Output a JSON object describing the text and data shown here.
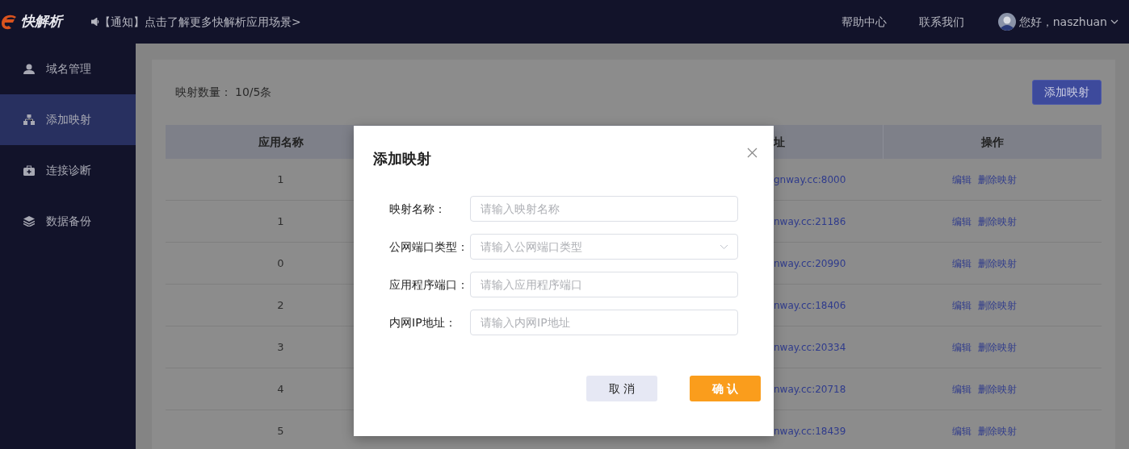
{
  "topbar": {
    "logo_text": "快解析",
    "notice": "【通知】点击了解更多快解析应用场景>",
    "links": [
      "帮助中心",
      "联系我们"
    ],
    "greeting": "您好，naszhuan"
  },
  "sidebar": {
    "items": [
      {
        "label": "域名管理",
        "selected": false
      },
      {
        "label": "添加映射",
        "selected": true
      },
      {
        "label": "连接诊断",
        "selected": false
      },
      {
        "label": "数据备份",
        "selected": false
      }
    ]
  },
  "summary": {
    "label": "映射数量：",
    "value": "10/5条"
  },
  "add_button": "添加映射",
  "table": {
    "columns": [
      {
        "label": "应用名称"
      },
      {
        "label": "址"
      },
      {
        "label": "操作"
      }
    ],
    "rows": [
      {
        "app_name": "1",
        "address": "gnway.cc:8000",
        "actions": [
          "编辑",
          "删除映射"
        ]
      },
      {
        "app_name": "1",
        "address": "nway.cc:21186",
        "actions": [
          "编辑",
          "删除映射"
        ]
      },
      {
        "app_name": "0",
        "address": "nway.cc:20990",
        "actions": [
          "编辑",
          "删除映射"
        ]
      },
      {
        "app_name": "2",
        "address": "nway.cc:18406",
        "actions": [
          "编辑",
          "删除映射"
        ]
      },
      {
        "app_name": "3",
        "address": "nway.cc:20334",
        "actions": [
          "编辑",
          "删除映射"
        ]
      },
      {
        "app_name": "4",
        "address": "nway.cc:20718",
        "actions": [
          "编辑",
          "删除映射"
        ]
      },
      {
        "app_name": "5",
        "address": "nway.cc:18439",
        "actions": [
          "编辑",
          "删除映射"
        ]
      }
    ]
  },
  "modal": {
    "title": "添加映射",
    "fields": [
      {
        "label": "映射名称：",
        "placeholder": "请输入映射名称",
        "kind": "input"
      },
      {
        "label": "公网端口类型：",
        "placeholder": "请输入公网端口类型",
        "kind": "select"
      },
      {
        "label": "应用程序端口：",
        "placeholder": "请输入应用程序端口",
        "kind": "input"
      },
      {
        "label": "内网IP地址：",
        "placeholder": "请输入内网IP地址",
        "kind": "input"
      }
    ],
    "buttons": [
      {
        "label": "取 消",
        "kind": "secondary"
      },
      {
        "label": "确 认",
        "kind": "primary"
      }
    ]
  }
}
